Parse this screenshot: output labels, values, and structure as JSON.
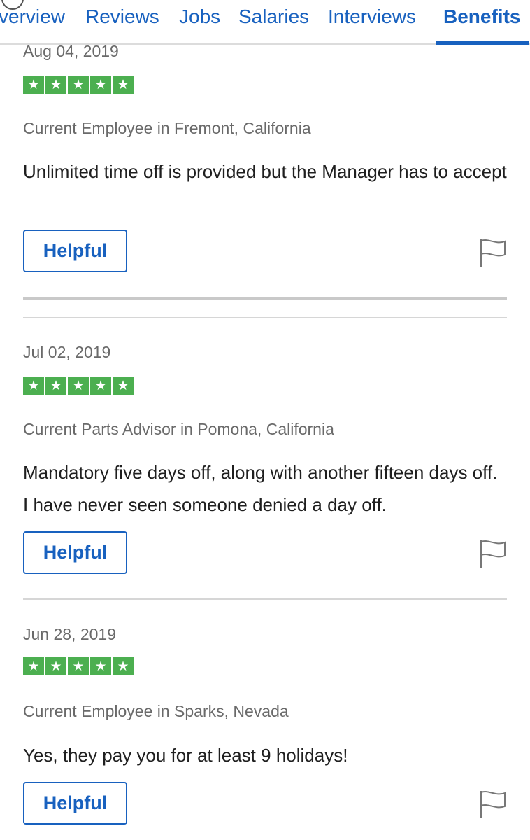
{
  "tabs": [
    {
      "label": "verview",
      "active": false
    },
    {
      "label": "Reviews",
      "active": false
    },
    {
      "label": "Jobs",
      "active": false
    },
    {
      "label": "Salaries",
      "active": false
    },
    {
      "label": "Interviews",
      "active": false
    },
    {
      "label": "Benefits",
      "active": true
    }
  ],
  "reviews": [
    {
      "date": "Aug 04, 2019",
      "rating": 5,
      "author": "Current Employee in Fremont, California",
      "text": "Unlimited time off is provided but the Manager has to accept",
      "helpful_label": "Helpful"
    },
    {
      "date": "Jul 02, 2019",
      "rating": 5,
      "author": "Current Parts Advisor in Pomona, California",
      "text": "Mandatory five days off, along with another fifteen days off. I have never seen someone denied a day off.",
      "helpful_label": "Helpful"
    },
    {
      "date": "Jun 28, 2019",
      "rating": 5,
      "author": "Current Employee in Sparks, Nevada",
      "text": "Yes, they pay you for at least 9 holidays!",
      "helpful_label": "Helpful"
    }
  ],
  "colors": {
    "accent": "#1861bf",
    "star_green": "#4caf50",
    "muted_text": "#6a6a6a"
  },
  "icons": {
    "star": "star-icon",
    "flag": "flag-icon"
  }
}
